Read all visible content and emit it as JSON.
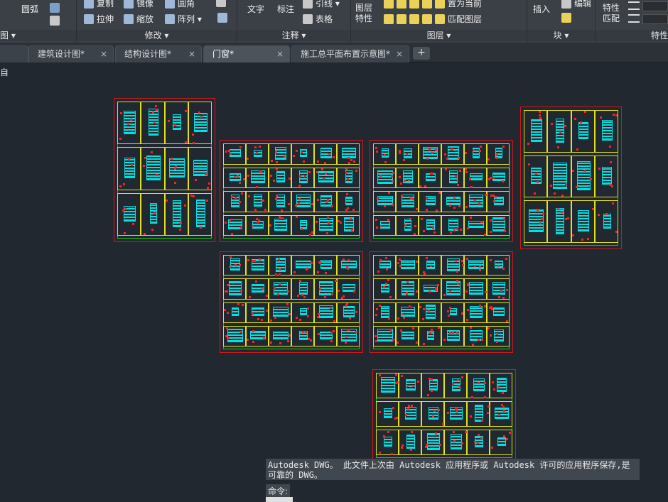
{
  "ribbon": {
    "panels": [
      {
        "title": "图 ▾",
        "buttons": [
          "圆弧"
        ]
      },
      {
        "title": "修改 ▾",
        "buttons": [
          "复制",
          "镜像",
          "圆角",
          "拉伸",
          "缩放",
          "阵列 ▾"
        ]
      },
      {
        "title": "注释 ▾",
        "buttons": [
          "文字",
          "标注",
          "引线 ▾",
          "表格"
        ]
      },
      {
        "title": "图层 ▾",
        "buttons": [
          "图层特性",
          "置为当前",
          "匹配图层"
        ]
      },
      {
        "title": "块 ▾",
        "buttons": [
          "插入",
          "编辑"
        ]
      },
      {
        "title": "特性",
        "buttons": [
          "特性匹配"
        ]
      }
    ]
  },
  "tabs": [
    {
      "label": "建筑设计图*",
      "close": "×"
    },
    {
      "label": "结构设计图*",
      "close": "×"
    },
    {
      "label": "门窗*",
      "close": "×",
      "active": true
    },
    {
      "label": "施工总平面布置示意图*",
      "close": "×"
    }
  ],
  "tab_add": "+",
  "canvas_corner": "自",
  "command": {
    "history": "Autodesk DWG。  此文件上次由 Autodesk 应用程序或 Autodesk 许可的应用程序保存,是可靠的 DWG。",
    "prompt": "命令:",
    "input_label": "命令"
  },
  "colors": {
    "background": "#212830",
    "ribbon": "#3b4047",
    "frame_red": "#d01818",
    "frame_green": "#18c818",
    "detail_cyan": "#00e0e0"
  }
}
